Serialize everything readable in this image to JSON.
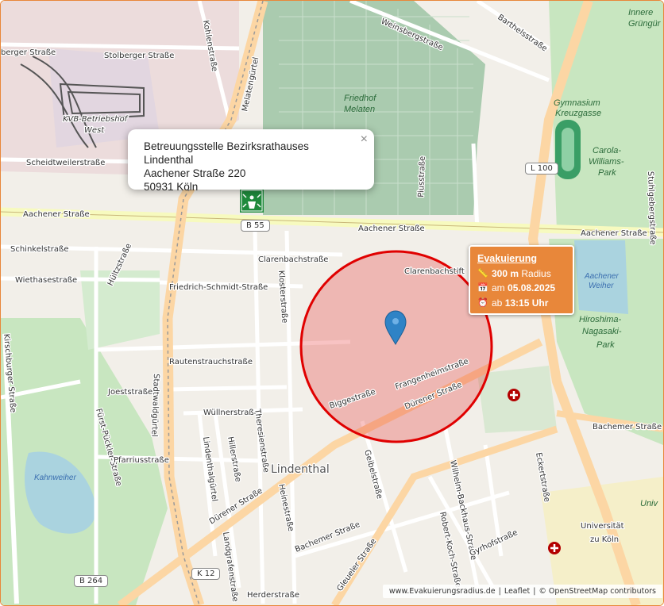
{
  "popup": {
    "line1": "Betreuungsstelle Bezirksrathauses Lindenthal",
    "line2": "Aachener Straße 220",
    "line3": "50931 Köln",
    "close": "×"
  },
  "evacuation": {
    "title": "Evakuierung",
    "radius_value": "300 m",
    "radius_label": "Radius",
    "date_prefix": "am",
    "date": "05.08.2025",
    "time_prefix": "ab",
    "time": "13:15 Uhr",
    "box_color": "#e8873a",
    "circle_color": "#e00000"
  },
  "attribution": {
    "site": "www.Evakuierungsradius.de",
    "leaflet": "Leaflet",
    "osm": "© OpenStreetMap contributors",
    "separator": "|"
  },
  "map": {
    "street_labels": {
      "stolberger_left": "berger Straße",
      "stolberger": "Stolberger Straße",
      "kohlen": "Kohlenstraße",
      "melaten": "Melatengürtel",
      "weinsberg": "Weinsbergstraße",
      "barthels": "Barthelsstraße",
      "scheidtweiler": "Scheidtweilerstraße",
      "aachener_left": "Aachener Straße",
      "aachener_mid": "Aachener Straße",
      "aachener_right": "Aachener Straße",
      "schinkel": "Schinkelstraße",
      "wiethase": "Wiethasestraße",
      "hultz": "Hültzstraße",
      "clarenbach": "Clarenbachstraße",
      "clarenbach_stift": "Clarenbachstift",
      "friedrich_schmidt": "Friedrich-Schmidt-Straße",
      "kloster": "Klosterstraße",
      "rautenstrauch": "Rautenstrauchstraße",
      "frangenheim": "Frangenheimstraße",
      "dueren_right": "Dürener Straße",
      "dueren_left": "Dürener Straße",
      "bigge": "Biggestraße",
      "joest": "Joeststraße",
      "wullner": "Wüllnerstraße",
      "theresien": "Theresienstraße",
      "furst_puckler": "Fürst-Pückler-Straße",
      "pfarrius": "Pfarriusstraße",
      "lindenthal_str": "Lindenthalgürtel",
      "hillers": "Hillerstraße",
      "bachemer_right": "Bachemer Straße",
      "bachemer_left": "Bachemer Straße",
      "gleueler": "Gleueler Straße",
      "geibel": "Geibelstraße",
      "wilhelm_backhaus": "Wilhelm-Backhaus-Straße",
      "robert_koch": "Robert-Koch-Straße",
      "gyrhof": "Gyrhofstraße",
      "eckert": "Eckertstraße",
      "kirschburger": "Kirschburger Straße",
      "stadtwaldguertel": "Stadtwaldgürtel",
      "herder": "Herderstraße",
      "landgrafen": "Landgrafenstraße",
      "stadtwaldguertel_pfad": "Pfarriusstraße",
      "heinestr": "Heinestraße",
      "piusstrasse": "Piusstraße",
      "stuhlgeberg": "Stuhlgebergstraße"
    },
    "place_labels": {
      "lindenthal": "Lindenthal",
      "friedhof_melaten_1": "Friedhof",
      "friedhof_melaten_2": "Melaten",
      "kvb_1": "KVB-Betriebshof",
      "kvb_2": "West",
      "gymnasium_1": "Gymnasium",
      "gymnasium_2": "Kreuzgasse",
      "carola_1": "Carola-",
      "carola_2": "Williams-",
      "carola_3": "Park",
      "aachener_weiher_1": "Aachener",
      "aachener_weiher_2": "Weiher",
      "hiroshima_1": "Hiroshima-",
      "hiroshima_2": "Nagasaki-",
      "hiroshima_3": "Park",
      "kahnweiher": "Kahnweiher",
      "universitaet_1": "Universität",
      "universitaet_2": "zu Köln",
      "uni_edge": "Univ",
      "inner_green_1": "Innere",
      "inner_green_2": "Grüngür"
    },
    "shields": {
      "b55": "B 55",
      "l100": "L 100",
      "b264": "B 264",
      "k12": "K 12"
    }
  }
}
